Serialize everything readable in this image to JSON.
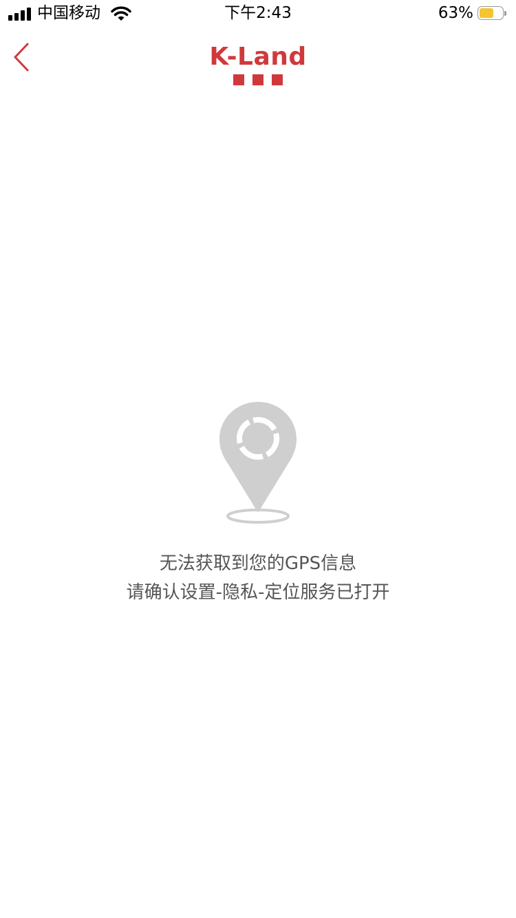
{
  "status_bar": {
    "carrier": "中国移动",
    "time": "下午2:43",
    "battery_percent": "63%",
    "battery_level": 0.63,
    "signal_icon": "signal-bars-icon",
    "wifi_icon": "wifi-icon",
    "battery_icon": "battery-icon",
    "battery_color": "#f4c431"
  },
  "nav": {
    "back_icon": "chevron-left-icon",
    "logo_text": "K-Land",
    "brand_color": "#d0393c"
  },
  "empty_state": {
    "icon": "location-pin-icon",
    "line1": "无法获取到您的GPS信息",
    "line2": "请确认设置-隐私-定位服务已打开",
    "icon_color": "#cfcfcf"
  }
}
